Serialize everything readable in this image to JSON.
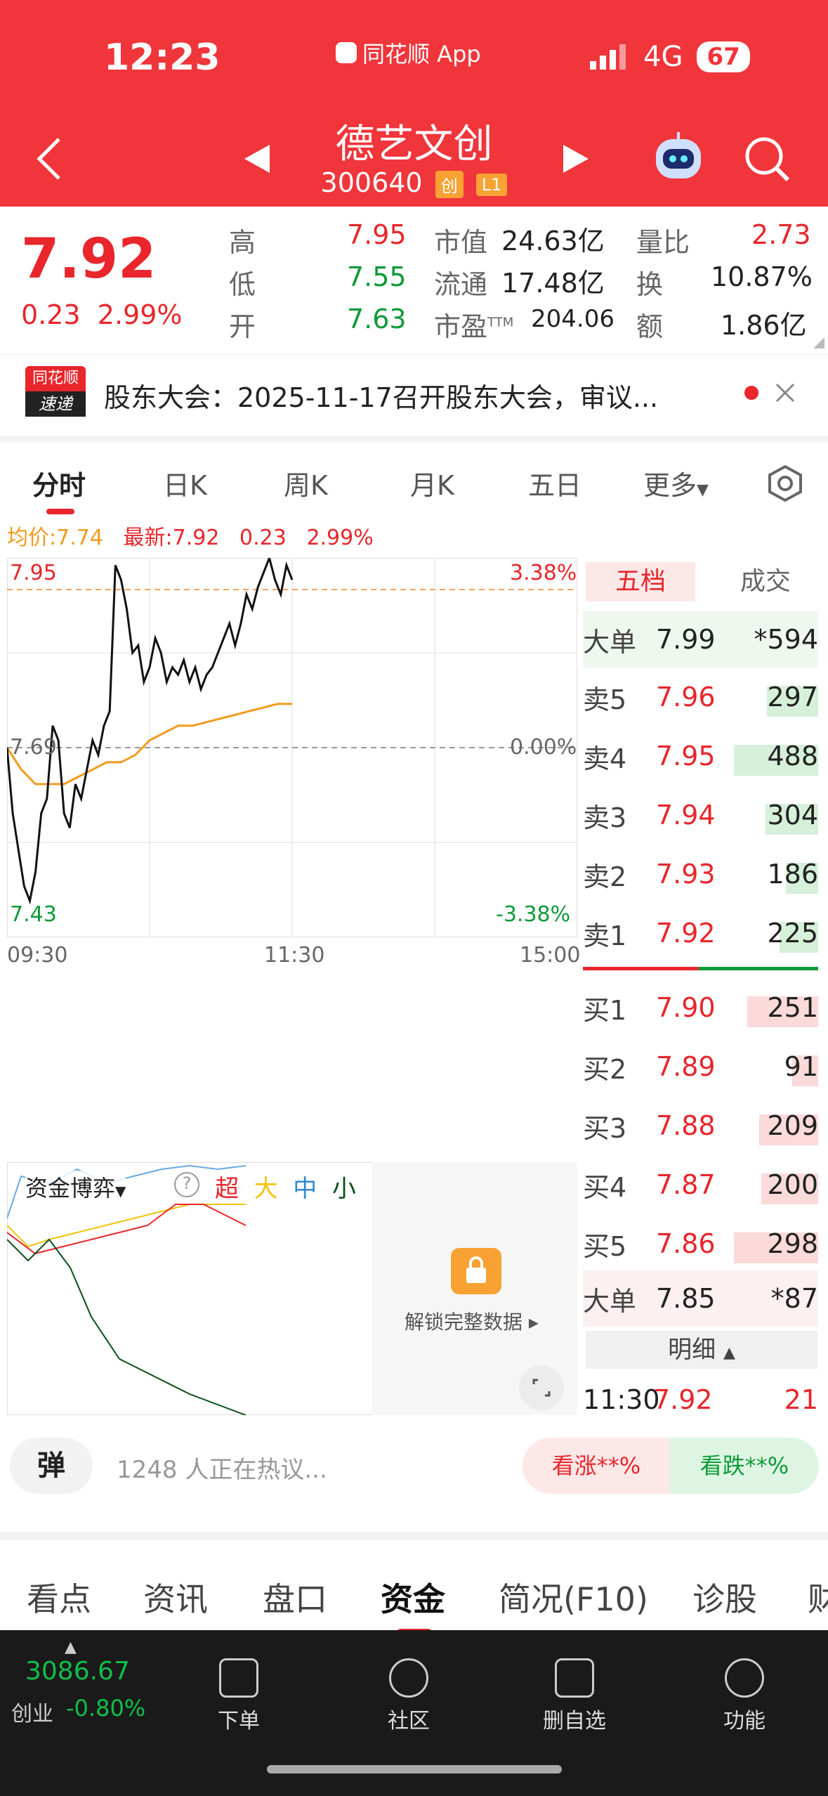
{
  "status": {
    "time": "12:23",
    "app": "同花顺 App",
    "network": "4G",
    "battery": "67"
  },
  "stock": {
    "name": "德艺文创",
    "code": "300640",
    "tag1": "创",
    "tag2": "L1"
  },
  "quote": {
    "price": "7.92",
    "change": "0.23",
    "pct": "2.99%",
    "high_label": "高",
    "high": "7.95",
    "low_label": "低",
    "low": "7.55",
    "open_label": "开",
    "open": "7.63",
    "mv_label": "市值",
    "mv": "24.63亿",
    "flow_label": "流通",
    "flow": "17.48亿",
    "pe_label": "市盈",
    "pe_sup": "TTM",
    "pe": "204.06",
    "ratio_label": "量比",
    "ratio": "2.73",
    "turn_label": "换",
    "turn": "10.87%",
    "amt_label": "额",
    "amt": "1.86亿"
  },
  "news": {
    "logo_top": "同花顺",
    "logo_bottom": "速递",
    "text": "股东大会：2025-11-17召开股东大会，审议..."
  },
  "tabs": [
    "分时",
    "日K",
    "周K",
    "月K",
    "五日",
    "更多"
  ],
  "chart_info": {
    "avg_label": "均价:",
    "avg": "7.74",
    "latest_label": "最新:",
    "latest": "7.92",
    "chg": "0.23",
    "pct": "2.99%"
  },
  "chart_data": {
    "type": "line",
    "y_top": "7.95",
    "y_bottom": "7.43",
    "y_mid": "7.69",
    "pct_top": "3.38%",
    "pct_mid": "0.00%",
    "pct_bottom": "-3.38%",
    "x_labels": [
      "09:30",
      "11:30",
      "15:00"
    ],
    "ylim": [
      7.43,
      7.95
    ],
    "price_values": [
      7.69,
      7.6,
      7.55,
      7.5,
      7.48,
      7.52,
      7.6,
      7.62,
      7.72,
      7.7,
      7.6,
      7.58,
      7.64,
      7.62,
      7.66,
      7.7,
      7.68,
      7.72,
      7.74,
      7.94,
      7.92,
      7.88,
      7.82,
      7.83,
      7.78,
      7.8,
      7.84,
      7.82,
      7.78,
      7.8,
      7.79,
      7.81,
      7.78,
      7.8,
      7.77,
      7.79,
      7.8,
      7.82,
      7.84,
      7.86,
      7.83,
      7.86,
      7.9,
      7.88,
      7.91,
      7.93,
      7.95,
      7.92,
      7.9,
      7.94,
      7.92
    ],
    "avg_values": [
      7.69,
      7.66,
      7.64,
      7.64,
      7.64,
      7.65,
      7.66,
      7.67,
      7.67,
      7.68,
      7.7,
      7.71,
      7.72,
      7.72,
      7.725,
      7.73,
      7.735,
      7.74,
      7.745,
      7.75,
      7.75
    ]
  },
  "orderbook": {
    "tab_active": "五档",
    "tab_other": "成交",
    "big_sell": {
      "label": "大单",
      "price": "7.99",
      "vol": "*594"
    },
    "asks": [
      {
        "label": "卖5",
        "price": "7.96",
        "vol": "297"
      },
      {
        "label": "卖4",
        "price": "7.95",
        "vol": "488"
      },
      {
        "label": "卖3",
        "price": "7.94",
        "vol": "304"
      },
      {
        "label": "卖2",
        "price": "7.93",
        "vol": "186"
      },
      {
        "label": "卖1",
        "price": "7.92",
        "vol": "225"
      }
    ],
    "bids": [
      {
        "label": "买1",
        "price": "7.90",
        "vol": "251"
      },
      {
        "label": "买2",
        "price": "7.89",
        "vol": "91"
      },
      {
        "label": "买3",
        "price": "7.88",
        "vol": "209"
      },
      {
        "label": "买4",
        "price": "7.87",
        "vol": "200"
      },
      {
        "label": "买5",
        "price": "7.86",
        "vol": "298"
      }
    ],
    "big_buy": {
      "label": "大单",
      "price": "7.85",
      "vol": "*87"
    },
    "detail_label": "明细",
    "trade": {
      "time": "11:30",
      "price": "7.92",
      "vol": "21"
    }
  },
  "fund": {
    "title": "资金博弈",
    "super": "超",
    "big": "大",
    "mid": "中",
    "small": "小",
    "unlock": "解锁完整数据"
  },
  "discuss": {
    "btn": "弹",
    "text": "1248 人正在热议...",
    "up": "看涨**%",
    "down": "看跌**%"
  },
  "bottom_tabs": [
    "看点",
    "资讯",
    "盘口",
    "资金",
    "简况(F10)",
    "诊股",
    "财"
  ],
  "footer": {
    "index_value": "3086.67",
    "index_name": "创业",
    "index_chg": "-0.80%",
    "items": [
      "下单",
      "社区",
      "删自选",
      "功能"
    ]
  },
  "colors": {
    "header": "#f0353b",
    "up": "#e8262b",
    "down": "#0e9a37"
  }
}
